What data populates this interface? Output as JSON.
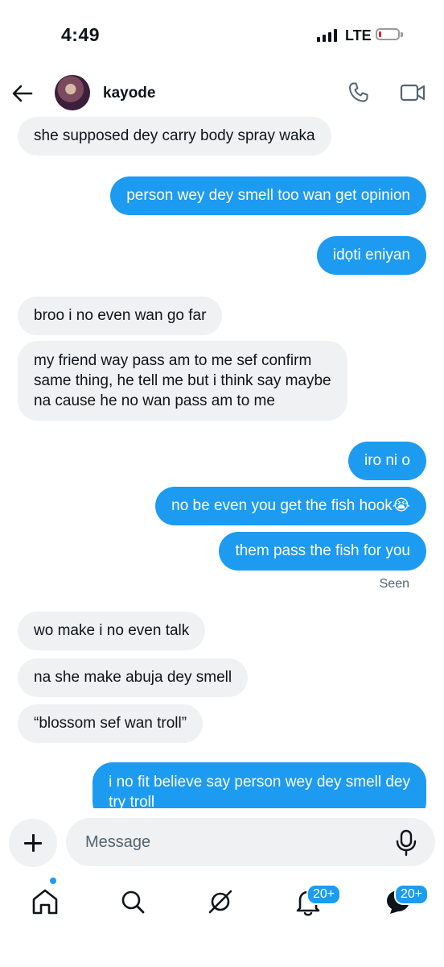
{
  "status_bar": {
    "time": "4:49",
    "network": "LTE"
  },
  "header": {
    "contact_name": "kayode"
  },
  "messages": [
    {
      "direction": "in",
      "text": "she supposed dey carry body spray waka"
    },
    {
      "direction": "out",
      "text": "person wey dey smell too wan get opinion"
    },
    {
      "direction": "out",
      "text": "idọti eniyan"
    },
    {
      "direction": "in",
      "text": "broo i no even wan go far"
    },
    {
      "direction": "in",
      "lines": [
        "my friend way pass am to me sef confirm",
        "same thing, he tell me but i think say maybe",
        "na cause he no wan pass am to me"
      ]
    },
    {
      "direction": "out",
      "text": "iro ni o"
    },
    {
      "direction": "out",
      "text": "no be even you get the fish hook",
      "emoji": "😭"
    },
    {
      "direction": "out",
      "text": "them pass the fish for you"
    },
    {
      "direction": "in",
      "text": "wo make i no even talk"
    },
    {
      "direction": "in",
      "text": "na she make abuja dey smell"
    },
    {
      "direction": "in",
      "text": "“blossom sef wan troll”"
    },
    {
      "direction": "out",
      "lines": [
        "i no fit believe say person wey dey smell dey",
        "try troll"
      ]
    }
  ],
  "seen_label": "Seen",
  "composer": {
    "placeholder": "Message"
  },
  "bottom_nav": {
    "notifications_badge": "20+",
    "messages_badge": "20+"
  },
  "colors": {
    "accent": "#1d9bf0",
    "incoming_bubble": "#eff1f3",
    "text": "#0f1419",
    "muted": "#536471"
  },
  "icons": [
    "back-arrow-icon",
    "phone-icon",
    "video-icon",
    "plus-icon",
    "mic-icon",
    "home-icon",
    "search-icon",
    "grok-icon",
    "bell-icon",
    "messages-icon"
  ]
}
